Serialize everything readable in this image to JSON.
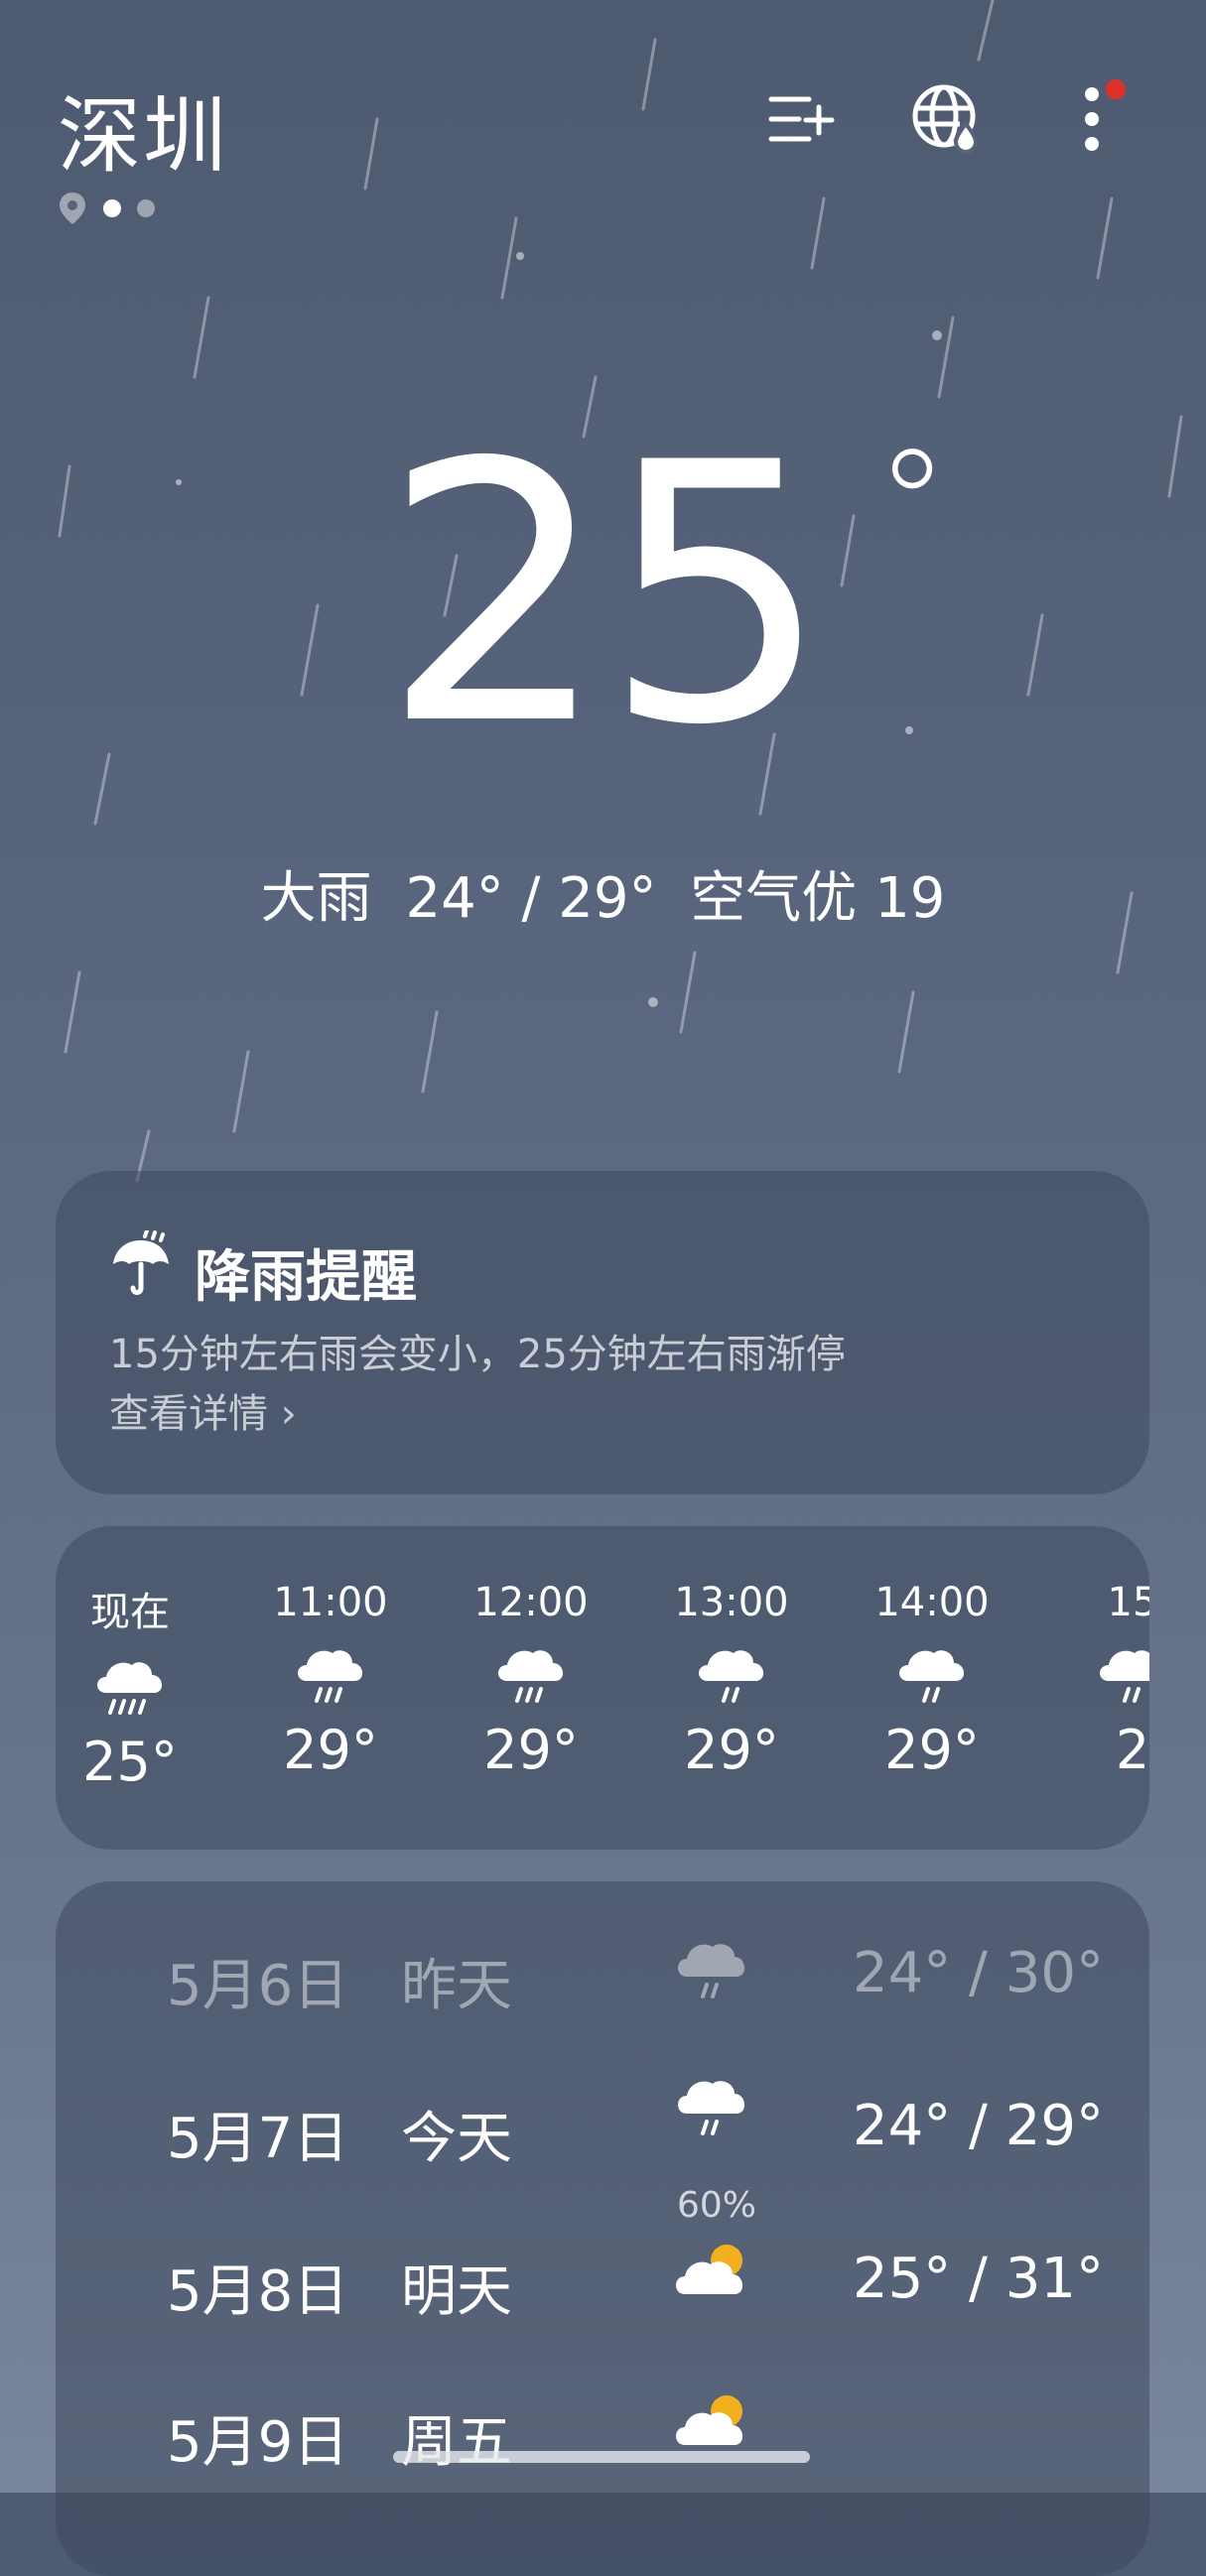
{
  "header": {
    "city": "深圳"
  },
  "current": {
    "temperature": "25",
    "degree": "°",
    "condition": "大雨",
    "range": "24° / 29°",
    "aqi": "空气优 19"
  },
  "rain_alert": {
    "title": "降雨提醒",
    "message": "15分钟左右雨会变小，25分钟左右雨渐停",
    "link": "查看详情 ›"
  },
  "hourly": [
    {
      "time": "现在",
      "temp": "25°",
      "icon": "heavy-rain"
    },
    {
      "time": "11:00",
      "temp": "29°",
      "icon": "rain"
    },
    {
      "time": "12:00",
      "temp": "29°",
      "icon": "rain"
    },
    {
      "time": "13:00",
      "temp": "29°",
      "icon": "light-rain"
    },
    {
      "time": "14:00",
      "temp": "29°",
      "icon": "light-rain"
    },
    {
      "time": "15",
      "temp": "2",
      "icon": "light-rain"
    }
  ],
  "daily": [
    {
      "date": "5月6日",
      "name": "昨天",
      "icon": "rain",
      "low": "24°",
      "sep": "/",
      "high": "30°",
      "pop": ""
    },
    {
      "date": "5月7日",
      "name": "今天",
      "icon": "rain",
      "low": "24°",
      "sep": "/",
      "high": "29°",
      "pop": "60%"
    },
    {
      "date": "5月8日",
      "name": "明天",
      "icon": "partly-cloudy",
      "low": "25°",
      "sep": "/",
      "high": "31°",
      "pop": ""
    },
    {
      "date": "5月9日",
      "name": "周五",
      "icon": "partly-cloudy",
      "low": "",
      "sep": "",
      "high": "",
      "pop": ""
    }
  ],
  "colors": {
    "accent_red": "#e0302c",
    "sun": "#f2b01e"
  }
}
